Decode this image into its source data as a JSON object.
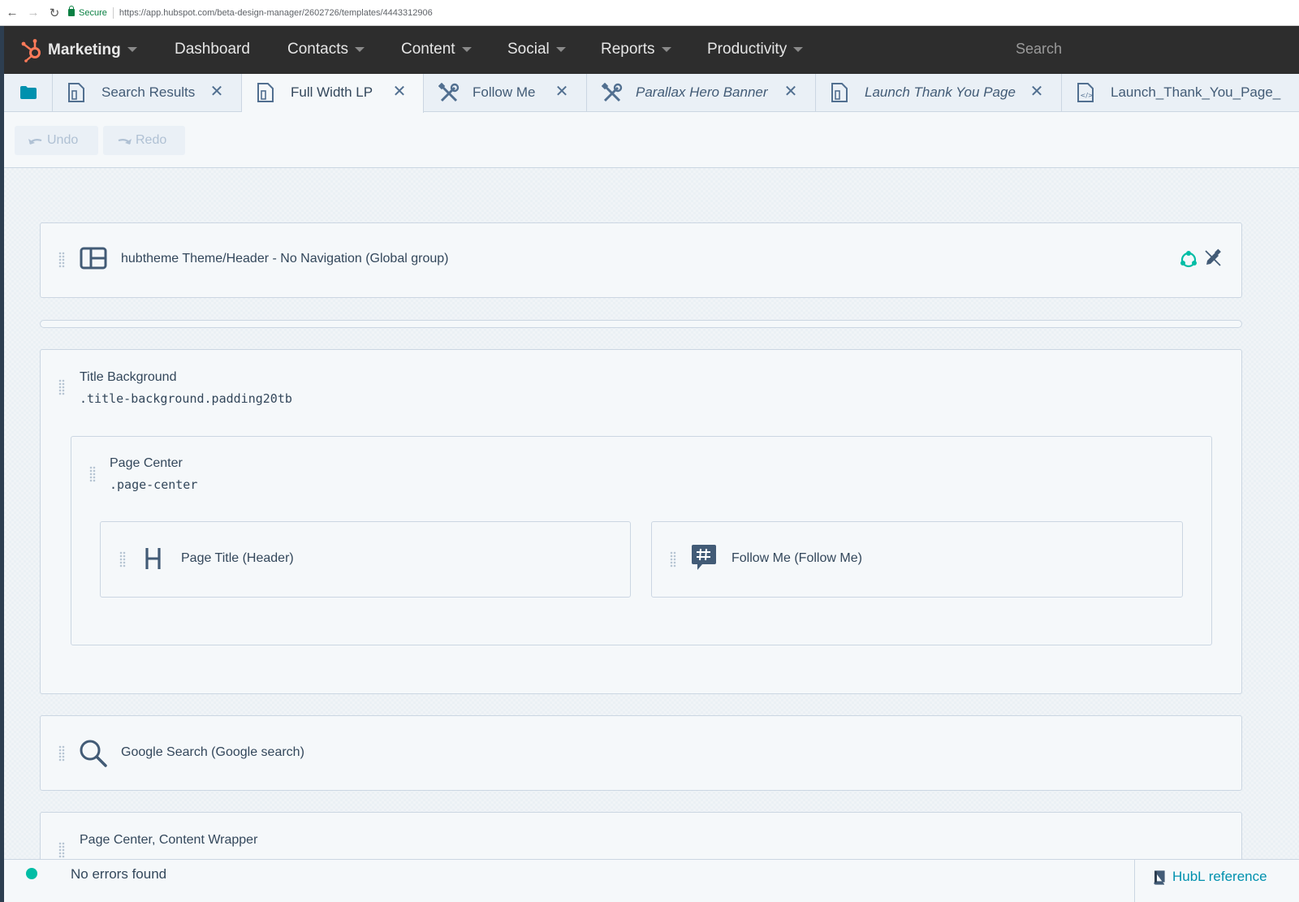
{
  "browser": {
    "secure_label": "Secure",
    "url": "https://app.hubspot.com/beta-design-manager/2602726/templates/4443312906"
  },
  "topnav": {
    "brand": "Marketing",
    "items": [
      {
        "label": "Dashboard",
        "has_caret": false
      },
      {
        "label": "Contacts",
        "has_caret": true
      },
      {
        "label": "Content",
        "has_caret": true
      },
      {
        "label": "Social",
        "has_caret": true
      },
      {
        "label": "Reports",
        "has_caret": true
      },
      {
        "label": "Productivity",
        "has_caret": true
      }
    ],
    "search_placeholder": "Search"
  },
  "tabs": [
    {
      "label": "Search Results",
      "icon": "page-icon",
      "italic": false,
      "active": false
    },
    {
      "label": "Full Width LP",
      "icon": "page-icon",
      "italic": false,
      "active": true
    },
    {
      "label": "Follow Me",
      "icon": "tools-icon",
      "italic": false,
      "active": false
    },
    {
      "label": "Parallax Hero Banner",
      "icon": "tools-icon",
      "italic": true,
      "active": false
    },
    {
      "label": "Launch Thank You Page",
      "icon": "page-icon",
      "italic": true,
      "active": false
    },
    {
      "label": "Launch_Thank_You_Page_",
      "icon": "code-file-icon",
      "italic": false,
      "active": false
    }
  ],
  "toolbar": {
    "undo_label": "Undo",
    "redo_label": "Redo"
  },
  "layout": {
    "header_group": {
      "label": "hubtheme Theme/Header - No Navigation (Global group)",
      "icon": "layout-icon"
    },
    "title_background": {
      "title": "Title Background",
      "class_name": ".title-background.padding20tb"
    },
    "page_center": {
      "title": "Page Center",
      "class_name": ".page-center"
    },
    "page_title_module": {
      "label": "Page Title (Header)",
      "icon": "header-h-icon"
    },
    "follow_me_module": {
      "label": "Follow Me (Follow Me)",
      "icon": "hashtag-bubble-icon"
    },
    "google_search_module": {
      "label": "Google Search (Google search)",
      "icon": "search-icon"
    },
    "content_wrapper": {
      "title": "Page Center, Content Wrapper"
    }
  },
  "status": {
    "message": "No errors found",
    "hubl_reference": "HubL reference"
  },
  "colors": {
    "nav_bg": "#2d2d2d",
    "hubspot_orange": "#ff7a59",
    "accent_teal": "#00bda5",
    "link_blue": "#0091ae",
    "text_dark": "#33475b",
    "border": "#cbd6e2"
  }
}
